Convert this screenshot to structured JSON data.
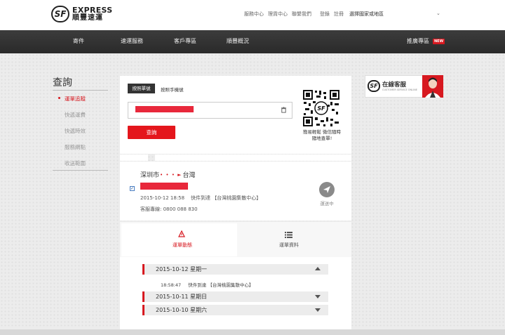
{
  "brand": {
    "badge": "SF",
    "name_en": "EXPRESS",
    "name_zh": "順豐速運",
    "accent": "#d71920"
  },
  "toplinks": {
    "service_center": "服務中心",
    "wealth_center": "理貨中心",
    "contact": "聯繫我們",
    "login": "登錄",
    "register": "註冊",
    "country": "選擇國家或地區"
  },
  "nav": {
    "items": [
      "寄件",
      "速運服務",
      "客戶專區",
      "順豐概況",
      "推廣專區"
    ],
    "new_badge": "NEW"
  },
  "sidebar": {
    "title": "查詢",
    "items": [
      "運單追蹤",
      "快遞運費",
      "快遞時效",
      "服務網點",
      "收送範圍"
    ],
    "active_index": 0
  },
  "query": {
    "tab_waybill": "按照單號",
    "tab_phone": "按照手機號",
    "button": "查詢",
    "qr_caption_line1": "簡易輕鬆 微信隨時",
    "qr_caption_line2": "隨地查單!"
  },
  "shipment": {
    "from": "深圳市",
    "to": "台灣",
    "checked": true,
    "datetime": "2015-10-12 18:58",
    "status_text": "快件到達 【台灣桃園集散中心】",
    "hotline_label": "客服專線:",
    "hotline": "0800 088 830",
    "state": "運送中"
  },
  "detail_tabs": {
    "dynamics": "運單動態",
    "info": "運單資料"
  },
  "timeline": {
    "days": [
      {
        "label": "2015-10-12 星期一",
        "expanded": true
      },
      {
        "label": "2015-10-11 星期日",
        "expanded": false
      },
      {
        "label": "2015-10-10 星期六",
        "expanded": false
      }
    ],
    "event_time": "18:58:47",
    "event_text": "快件到達 【台灣桃園集散中心】"
  },
  "customer_service": {
    "title": "在線客服",
    "subtitle": "CUSTOMER SERVICE ONLINE"
  }
}
